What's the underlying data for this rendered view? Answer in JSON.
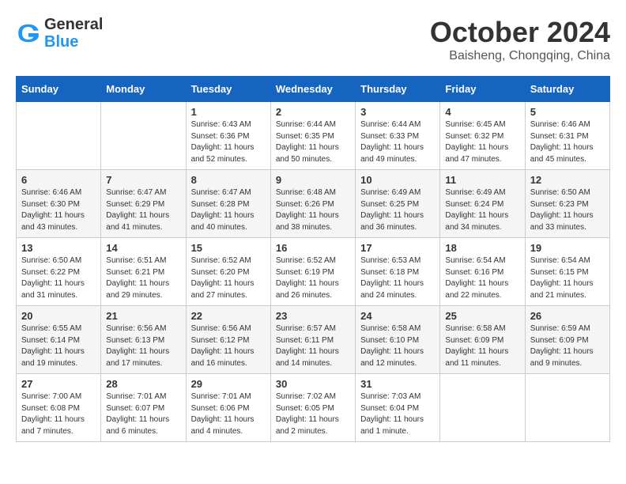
{
  "header": {
    "logo_line1": "General",
    "logo_line2": "Blue",
    "month_title": "October 2024",
    "location": "Baisheng, Chongqing, China"
  },
  "weekdays": [
    "Sunday",
    "Monday",
    "Tuesday",
    "Wednesday",
    "Thursday",
    "Friday",
    "Saturday"
  ],
  "weeks": [
    [
      {
        "day": "",
        "info": ""
      },
      {
        "day": "",
        "info": ""
      },
      {
        "day": "1",
        "info": "Sunrise: 6:43 AM\nSunset: 6:36 PM\nDaylight: 11 hours\nand 52 minutes."
      },
      {
        "day": "2",
        "info": "Sunrise: 6:44 AM\nSunset: 6:35 PM\nDaylight: 11 hours\nand 50 minutes."
      },
      {
        "day": "3",
        "info": "Sunrise: 6:44 AM\nSunset: 6:33 PM\nDaylight: 11 hours\nand 49 minutes."
      },
      {
        "day": "4",
        "info": "Sunrise: 6:45 AM\nSunset: 6:32 PM\nDaylight: 11 hours\nand 47 minutes."
      },
      {
        "day": "5",
        "info": "Sunrise: 6:46 AM\nSunset: 6:31 PM\nDaylight: 11 hours\nand 45 minutes."
      }
    ],
    [
      {
        "day": "6",
        "info": "Sunrise: 6:46 AM\nSunset: 6:30 PM\nDaylight: 11 hours\nand 43 minutes."
      },
      {
        "day": "7",
        "info": "Sunrise: 6:47 AM\nSunset: 6:29 PM\nDaylight: 11 hours\nand 41 minutes."
      },
      {
        "day": "8",
        "info": "Sunrise: 6:47 AM\nSunset: 6:28 PM\nDaylight: 11 hours\nand 40 minutes."
      },
      {
        "day": "9",
        "info": "Sunrise: 6:48 AM\nSunset: 6:26 PM\nDaylight: 11 hours\nand 38 minutes."
      },
      {
        "day": "10",
        "info": "Sunrise: 6:49 AM\nSunset: 6:25 PM\nDaylight: 11 hours\nand 36 minutes."
      },
      {
        "day": "11",
        "info": "Sunrise: 6:49 AM\nSunset: 6:24 PM\nDaylight: 11 hours\nand 34 minutes."
      },
      {
        "day": "12",
        "info": "Sunrise: 6:50 AM\nSunset: 6:23 PM\nDaylight: 11 hours\nand 33 minutes."
      }
    ],
    [
      {
        "day": "13",
        "info": "Sunrise: 6:50 AM\nSunset: 6:22 PM\nDaylight: 11 hours\nand 31 minutes."
      },
      {
        "day": "14",
        "info": "Sunrise: 6:51 AM\nSunset: 6:21 PM\nDaylight: 11 hours\nand 29 minutes."
      },
      {
        "day": "15",
        "info": "Sunrise: 6:52 AM\nSunset: 6:20 PM\nDaylight: 11 hours\nand 27 minutes."
      },
      {
        "day": "16",
        "info": "Sunrise: 6:52 AM\nSunset: 6:19 PM\nDaylight: 11 hours\nand 26 minutes."
      },
      {
        "day": "17",
        "info": "Sunrise: 6:53 AM\nSunset: 6:18 PM\nDaylight: 11 hours\nand 24 minutes."
      },
      {
        "day": "18",
        "info": "Sunrise: 6:54 AM\nSunset: 6:16 PM\nDaylight: 11 hours\nand 22 minutes."
      },
      {
        "day": "19",
        "info": "Sunrise: 6:54 AM\nSunset: 6:15 PM\nDaylight: 11 hours\nand 21 minutes."
      }
    ],
    [
      {
        "day": "20",
        "info": "Sunrise: 6:55 AM\nSunset: 6:14 PM\nDaylight: 11 hours\nand 19 minutes."
      },
      {
        "day": "21",
        "info": "Sunrise: 6:56 AM\nSunset: 6:13 PM\nDaylight: 11 hours\nand 17 minutes."
      },
      {
        "day": "22",
        "info": "Sunrise: 6:56 AM\nSunset: 6:12 PM\nDaylight: 11 hours\nand 16 minutes."
      },
      {
        "day": "23",
        "info": "Sunrise: 6:57 AM\nSunset: 6:11 PM\nDaylight: 11 hours\nand 14 minutes."
      },
      {
        "day": "24",
        "info": "Sunrise: 6:58 AM\nSunset: 6:10 PM\nDaylight: 11 hours\nand 12 minutes."
      },
      {
        "day": "25",
        "info": "Sunrise: 6:58 AM\nSunset: 6:09 PM\nDaylight: 11 hours\nand 11 minutes."
      },
      {
        "day": "26",
        "info": "Sunrise: 6:59 AM\nSunset: 6:09 PM\nDaylight: 11 hours\nand 9 minutes."
      }
    ],
    [
      {
        "day": "27",
        "info": "Sunrise: 7:00 AM\nSunset: 6:08 PM\nDaylight: 11 hours\nand 7 minutes."
      },
      {
        "day": "28",
        "info": "Sunrise: 7:01 AM\nSunset: 6:07 PM\nDaylight: 11 hours\nand 6 minutes."
      },
      {
        "day": "29",
        "info": "Sunrise: 7:01 AM\nSunset: 6:06 PM\nDaylight: 11 hours\nand 4 minutes."
      },
      {
        "day": "30",
        "info": "Sunrise: 7:02 AM\nSunset: 6:05 PM\nDaylight: 11 hours\nand 2 minutes."
      },
      {
        "day": "31",
        "info": "Sunrise: 7:03 AM\nSunset: 6:04 PM\nDaylight: 11 hours\nand 1 minute."
      },
      {
        "day": "",
        "info": ""
      },
      {
        "day": "",
        "info": ""
      }
    ]
  ]
}
